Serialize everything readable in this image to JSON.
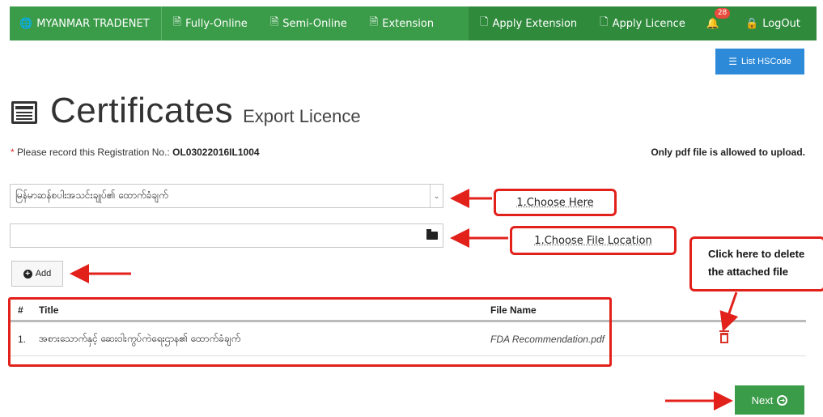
{
  "nav": {
    "brand": "MYANMAR TRADENET",
    "items": [
      "Fully-Online",
      "Semi-Online",
      "Extension"
    ],
    "right_items": [
      "Apply Extension",
      "Apply Licence"
    ],
    "notification_count": "28",
    "logout": "LogOut"
  },
  "toolbar": {
    "list_hscode": "List HSCode"
  },
  "page": {
    "title": "Certificates",
    "subtitle": "Export Licence",
    "registration_prefix": "Please record this Registration No.:",
    "registration_no": "OL03022016IL1004",
    "pdf_note": "Only pdf file is allowed to upload."
  },
  "form": {
    "document_type_selected": "မြန်မာဆန်စပါးအသင်းချုပ်၏ ထောက်ခံချက်",
    "add_button": "Add"
  },
  "table": {
    "headers": {
      "num": "#",
      "title": "Title",
      "file": "File Name"
    },
    "rows": [
      {
        "num": "1.",
        "title": "အစားသောက်နှင့် ဆေးဝါးကွပ်ကဲရေးဌာန၏ ထောက်ခံချက်",
        "file": "FDA Recommendation.pdf"
      }
    ]
  },
  "next_button": "Next",
  "annotations": {
    "choose_here": "1.Choose Here",
    "choose_file": "1.Choose File Location",
    "delete_line1": "Click here to delete",
    "delete_line2": "the attached file"
  },
  "colors": {
    "nav_green": "#3a9b48",
    "hscode_blue": "#2d8ad8",
    "annotation_red": "#e2211b"
  }
}
